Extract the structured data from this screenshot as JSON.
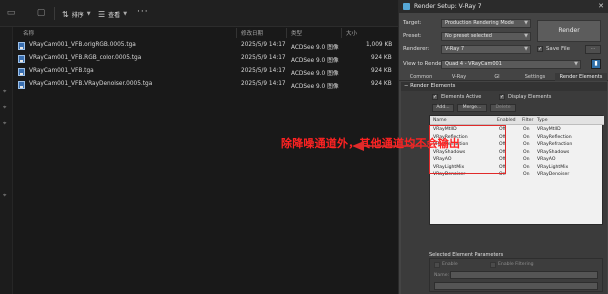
{
  "explorer": {
    "toolbar": {
      "sort_label": "排序",
      "view_label": "查看"
    },
    "columns": [
      "名称",
      "修改日期",
      "类型",
      "大小"
    ],
    "files": [
      {
        "name": "VRayCam001_VFB.origRGB.0005.tga",
        "date": "2025/5/9 14:17",
        "type": "ACDSee 9.0 图像",
        "size": "1,009 KB"
      },
      {
        "name": "VRayCam001_VFB.RGB_color.0005.tga",
        "date": "2025/5/9 14:17",
        "type": "ACDSee 9.0 图像",
        "size": "924 KB"
      },
      {
        "name": "VRayCam001_VFB.tga",
        "date": "2025/5/9 14:17",
        "type": "ACDSee 9.0 图像",
        "size": "924 KB"
      },
      {
        "name": "VRayCam001_VFB.VRayDenoiser.0005.tga",
        "date": "2025/5/9 14:17",
        "type": "ACDSee 9.0 图像",
        "size": "924 KB"
      }
    ]
  },
  "annotation": {
    "text": "除降噪通道外，其他通道均不会输出",
    "color": "#ff2222"
  },
  "dialog": {
    "title": "Render Setup: V-Ray 7",
    "target_label": "Target:",
    "target_value": "Production Rendering Mode",
    "preset_label": "Preset:",
    "preset_value": "No preset selected",
    "renderer_label": "Renderer:",
    "renderer_value": "V-Ray 7",
    "save_file_label": "Save File",
    "view_label": "View to Render:",
    "view_value": "Quad 4 - VRayCam001",
    "render_button": "Render",
    "tabs": [
      "Common",
      "V-Ray",
      "GI",
      "Settings",
      "Render Elements"
    ],
    "rollout_title": "Render Elements",
    "elements_active": "Elements Active",
    "display_elements": "Display Elements",
    "add_btn": "Add...",
    "merge_btn": "Merge...",
    "delete_btn": "Delete",
    "list_headers": [
      "Name",
      "Enabled",
      "Filter",
      "Type"
    ],
    "elements": [
      {
        "name": "VRayMtlID",
        "enabled": "Off",
        "filter": "On",
        "type": "VRayMtlID"
      },
      {
        "name": "VRayReflection",
        "enabled": "Off",
        "filter": "On",
        "type": "VRayReflection"
      },
      {
        "name": "VRayRefraction",
        "enabled": "Off",
        "filter": "On",
        "type": "VRayRefraction"
      },
      {
        "name": "VRayShadows",
        "enabled": "Off",
        "filter": "On",
        "type": "VRayShadows"
      },
      {
        "name": "VRayAO",
        "enabled": "Off",
        "filter": "On",
        "type": "VRayAO"
      },
      {
        "name": "VRayLightMix",
        "enabled": "Off",
        "filter": "On",
        "type": "VRayLightMix"
      },
      {
        "name": "VRayDenoiser",
        "enabled": "On",
        "filter": "On",
        "type": "VRayDenoiser"
      }
    ],
    "selected_params_title": "Selected Element Parameters",
    "enable_label": "Enable",
    "enable_filtering_label": "Enable Filtering",
    "name_label": "Name:"
  }
}
